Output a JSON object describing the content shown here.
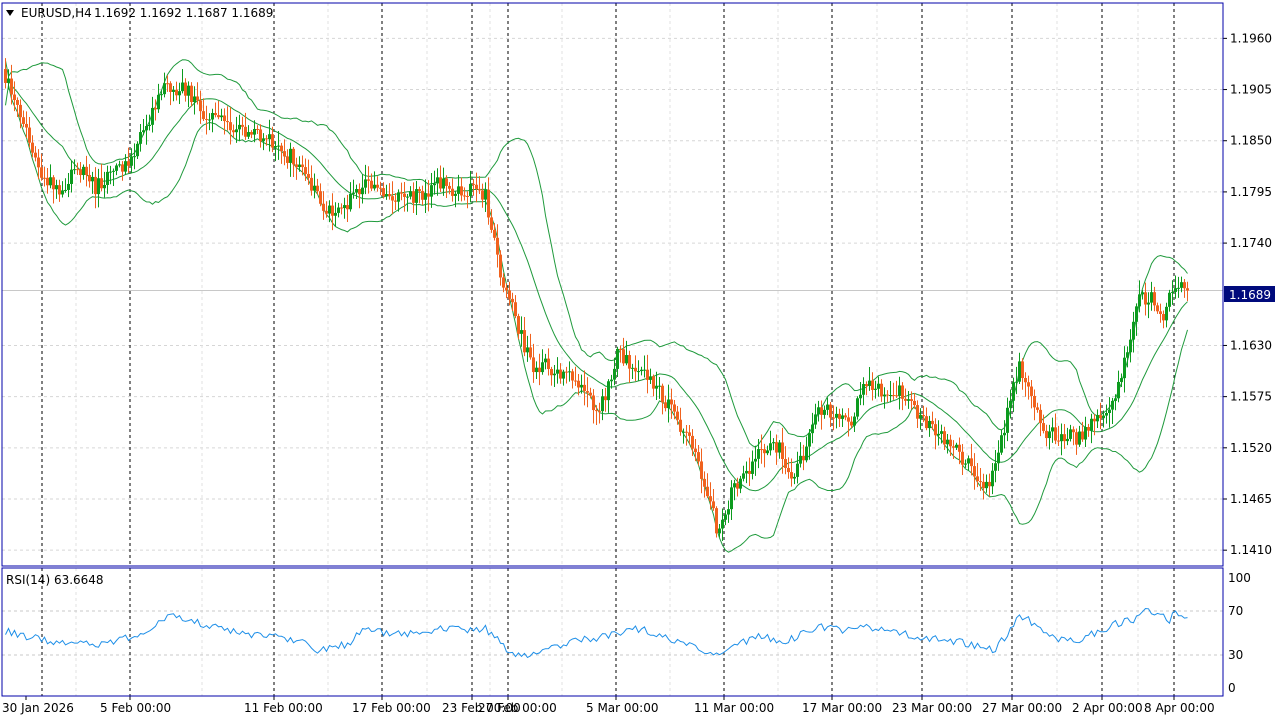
{
  "header": {
    "symbol_label": "EURUSD,H4",
    "ohlc": "1.1692 1.1692 1.1687 1.1689"
  },
  "rsi_panel": {
    "label": "RSI(14) 63.6648"
  },
  "current_price_label": "1.1689",
  "colors": {
    "up_candle": "#0c9b1e",
    "down_candle": "#f0621e",
    "bollinger": "#1f9a3c",
    "rsi_line": "#1e8fe8",
    "frame": "#0000aa",
    "price_tag_bg": "#000a7c"
  },
  "chart_data": [
    {
      "type": "candlestick",
      "title": "",
      "symbol": "EURUSD",
      "timeframe": "H4",
      "x_ticks": [
        "30 Jan 2026",
        "5 Feb 00:00",
        "11 Feb 00:00",
        "17 Feb 00:00",
        "23 Feb 00:00",
        "27 Feb 00:00",
        "5 Mar 00:00",
        "11 Mar 00:00",
        "17 Mar 00:00",
        "23 Mar 00:00",
        "27 Mar 00:00",
        "2 Apr 00:00",
        "8 Apr 00:00"
      ],
      "y_ticks": [
        "1.1960",
        "1.1905",
        "1.1850",
        "1.1795",
        "1.1740",
        "1.1630",
        "1.1575",
        "1.1520",
        "1.1465",
        "1.1410"
      ],
      "ylim": [
        1.1393,
        1.1998
      ],
      "grid": true,
      "overlay": "Bollinger Bands",
      "close_anchors": [
        [
          0,
          1.192
        ],
        [
          6,
          1.187
        ],
        [
          12,
          1.1815
        ],
        [
          18,
          1.1795
        ],
        [
          24,
          1.182
        ],
        [
          30,
          1.18
        ],
        [
          36,
          1.1815
        ],
        [
          42,
          1.183
        ],
        [
          48,
          1.1875
        ],
        [
          54,
          1.191
        ],
        [
          60,
          1.1905
        ],
        [
          66,
          1.188
        ],
        [
          72,
          1.187
        ],
        [
          78,
          1.1865
        ],
        [
          84,
          1.1855
        ],
        [
          90,
          1.1845
        ],
        [
          96,
          1.183
        ],
        [
          102,
          1.18
        ],
        [
          108,
          1.1775
        ],
        [
          114,
          1.178
        ],
        [
          120,
          1.1805
        ],
        [
          126,
          1.179
        ],
        [
          132,
          1.1785
        ],
        [
          138,
          1.179
        ],
        [
          144,
          1.1805
        ],
        [
          150,
          1.1795
        ],
        [
          156,
          1.1795
        ],
        [
          160,
          1.179
        ],
        [
          164,
          1.172
        ],
        [
          168,
          1.168
        ],
        [
          172,
          1.164
        ],
        [
          176,
          1.16
        ],
        [
          180,
          1.161
        ],
        [
          186,
          1.16
        ],
        [
          192,
          1.158
        ],
        [
          198,
          1.156
        ],
        [
          204,
          1.162
        ],
        [
          210,
          1.161
        ],
        [
          216,
          1.159
        ],
        [
          222,
          1.156
        ],
        [
          228,
          1.153
        ],
        [
          234,
          1.147
        ],
        [
          238,
          1.1425
        ],
        [
          242,
          1.147
        ],
        [
          248,
          1.15
        ],
        [
          254,
          1.1525
        ],
        [
          258,
          1.152
        ],
        [
          262,
          1.149
        ],
        [
          266,
          1.1515
        ],
        [
          270,
          1.1555
        ],
        [
          276,
          1.156
        ],
        [
          282,
          1.154
        ],
        [
          286,
          1.1595
        ],
        [
          292,
          1.158
        ],
        [
          298,
          1.158
        ],
        [
          304,
          1.156
        ],
        [
          310,
          1.154
        ],
        [
          316,
          1.152
        ],
        [
          322,
          1.15
        ],
        [
          326,
          1.147
        ],
        [
          330,
          1.15
        ],
        [
          334,
          1.156
        ],
        [
          338,
          1.1605
        ],
        [
          342,
          1.157
        ],
        [
          346,
          1.154
        ],
        [
          352,
          1.1535
        ],
        [
          358,
          1.153
        ],
        [
          362,
          1.155
        ],
        [
          368,
          1.1555
        ],
        [
          374,
          1.162
        ],
        [
          378,
          1.168
        ],
        [
          382,
          1.168
        ],
        [
          386,
          1.1665
        ],
        [
          390,
          1.17
        ],
        [
          394,
          1.1689
        ]
      ],
      "rsi": {
        "period": 14,
        "value": 63.6648,
        "levels": [
          30,
          70
        ],
        "ylim": [
          0,
          100
        ],
        "y_ticks": [
          "100",
          "70",
          "30",
          "0"
        ],
        "anchors": [
          [
            0,
            52
          ],
          [
            10,
            45
          ],
          [
            20,
            40
          ],
          [
            30,
            40
          ],
          [
            40,
            45
          ],
          [
            48,
            52
          ],
          [
            54,
            67
          ],
          [
            60,
            64
          ],
          [
            66,
            57
          ],
          [
            72,
            54
          ],
          [
            84,
            48
          ],
          [
            96,
            44
          ],
          [
            104,
            35
          ],
          [
            108,
            36
          ],
          [
            114,
            40
          ],
          [
            120,
            56
          ],
          [
            128,
            48
          ],
          [
            138,
            50
          ],
          [
            146,
            55
          ],
          [
            156,
            53
          ],
          [
            160,
            54
          ],
          [
            166,
            38
          ],
          [
            172,
            28
          ],
          [
            180,
            36
          ],
          [
            190,
            43
          ],
          [
            198,
            46
          ],
          [
            206,
            52
          ],
          [
            212,
            54
          ],
          [
            220,
            45
          ],
          [
            228,
            38
          ],
          [
            234,
            33
          ],
          [
            238,
            30
          ],
          [
            244,
            40
          ],
          [
            252,
            47
          ],
          [
            260,
            42
          ],
          [
            266,
            50
          ],
          [
            272,
            55
          ],
          [
            280,
            53
          ],
          [
            286,
            57
          ],
          [
            294,
            52
          ],
          [
            302,
            48
          ],
          [
            310,
            45
          ],
          [
            318,
            42
          ],
          [
            324,
            38
          ],
          [
            330,
            35
          ],
          [
            334,
            50
          ],
          [
            338,
            65
          ],
          [
            344,
            58
          ],
          [
            350,
            45
          ],
          [
            358,
            43
          ],
          [
            364,
            51
          ],
          [
            370,
            58
          ],
          [
            376,
            62
          ],
          [
            380,
            75
          ],
          [
            384,
            66
          ],
          [
            388,
            62
          ],
          [
            390,
            68
          ],
          [
            394,
            64
          ]
        ]
      }
    }
  ]
}
